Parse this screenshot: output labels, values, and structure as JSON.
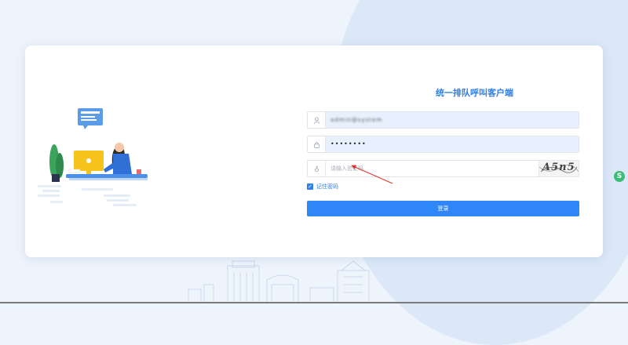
{
  "app": {
    "title": "统一排队呼叫客户端"
  },
  "login_form": {
    "username_value": "admin@system",
    "password_value": "••••••••",
    "captcha_placeholder": "请输入验证码",
    "captcha_text": "A5n5",
    "remember_label": "记住密码",
    "remember_checked": true,
    "login_label": "登录"
  },
  "icons": {
    "username": "user-icon",
    "password": "lock-icon",
    "captcha": "key-icon",
    "side_logo": "app-logo-icon"
  },
  "colors": {
    "accent": "#2f86f6",
    "title": "#2f7fe6",
    "field_fill": "#e8f0fe",
    "background": "#eef4fc"
  }
}
